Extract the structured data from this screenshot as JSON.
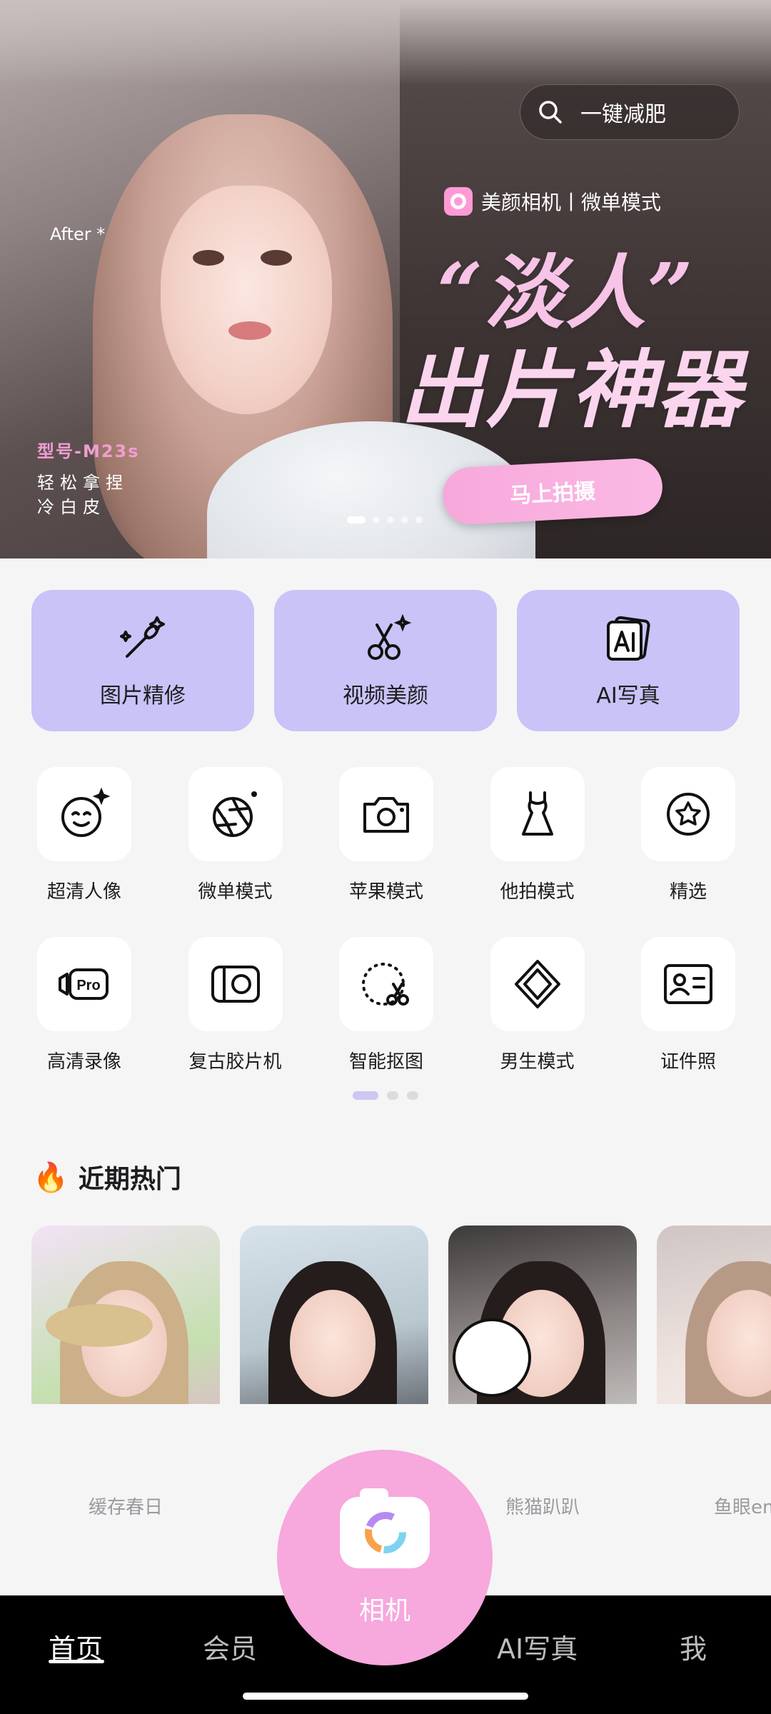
{
  "banner": {
    "search_text": "一键减肥",
    "brand_text": "美颜相机丨微单模式",
    "headline_line1": "“淡人”",
    "headline_line2": "出片神器",
    "cta_label": "马上拍摄",
    "after_label": "After *",
    "model_label": "型号-M23s",
    "tagline_1": "轻松拿捏",
    "tagline_2": "冷白皮",
    "slides_total": 5,
    "slide_active": 1
  },
  "features": [
    {
      "label": "图片精修",
      "icon": "magic-wand-icon"
    },
    {
      "label": "视频美颜",
      "icon": "scissors-sparkle-icon"
    },
    {
      "label": "AI写真",
      "icon": "ai-photo-icon"
    }
  ],
  "tools_row1": [
    {
      "label": "超清人像",
      "icon": "face-sparkle-icon"
    },
    {
      "label": "微单模式",
      "icon": "aperture-icon"
    },
    {
      "label": "苹果模式",
      "icon": "camera-icon"
    },
    {
      "label": "他拍模式",
      "icon": "dress-icon"
    },
    {
      "label": "精选",
      "icon": "star-circle-icon"
    }
  ],
  "tools_row2": [
    {
      "label": "高清录像",
      "icon": "pro-video-icon"
    },
    {
      "label": "复古胶片机",
      "icon": "film-camera-icon"
    },
    {
      "label": "智能抠图",
      "icon": "cutout-scissors-icon"
    },
    {
      "label": "男生模式",
      "icon": "diamond-icon"
    },
    {
      "label": "证件照",
      "icon": "id-card-icon"
    }
  ],
  "grid_pages": {
    "total": 3,
    "active": 1
  },
  "hot": {
    "title": "近期热门",
    "items": [
      "缓存春日",
      "熊猫趴趴",
      "鱼眼em"
    ]
  },
  "nav": {
    "home": "首页",
    "vip": "会员",
    "camera": "相机",
    "ai": "AI写真",
    "me": "我"
  },
  "colors": {
    "accent_purple": "#c9c3f8",
    "accent_pink": "#f7a8dd",
    "nav_bg": "#000000"
  }
}
